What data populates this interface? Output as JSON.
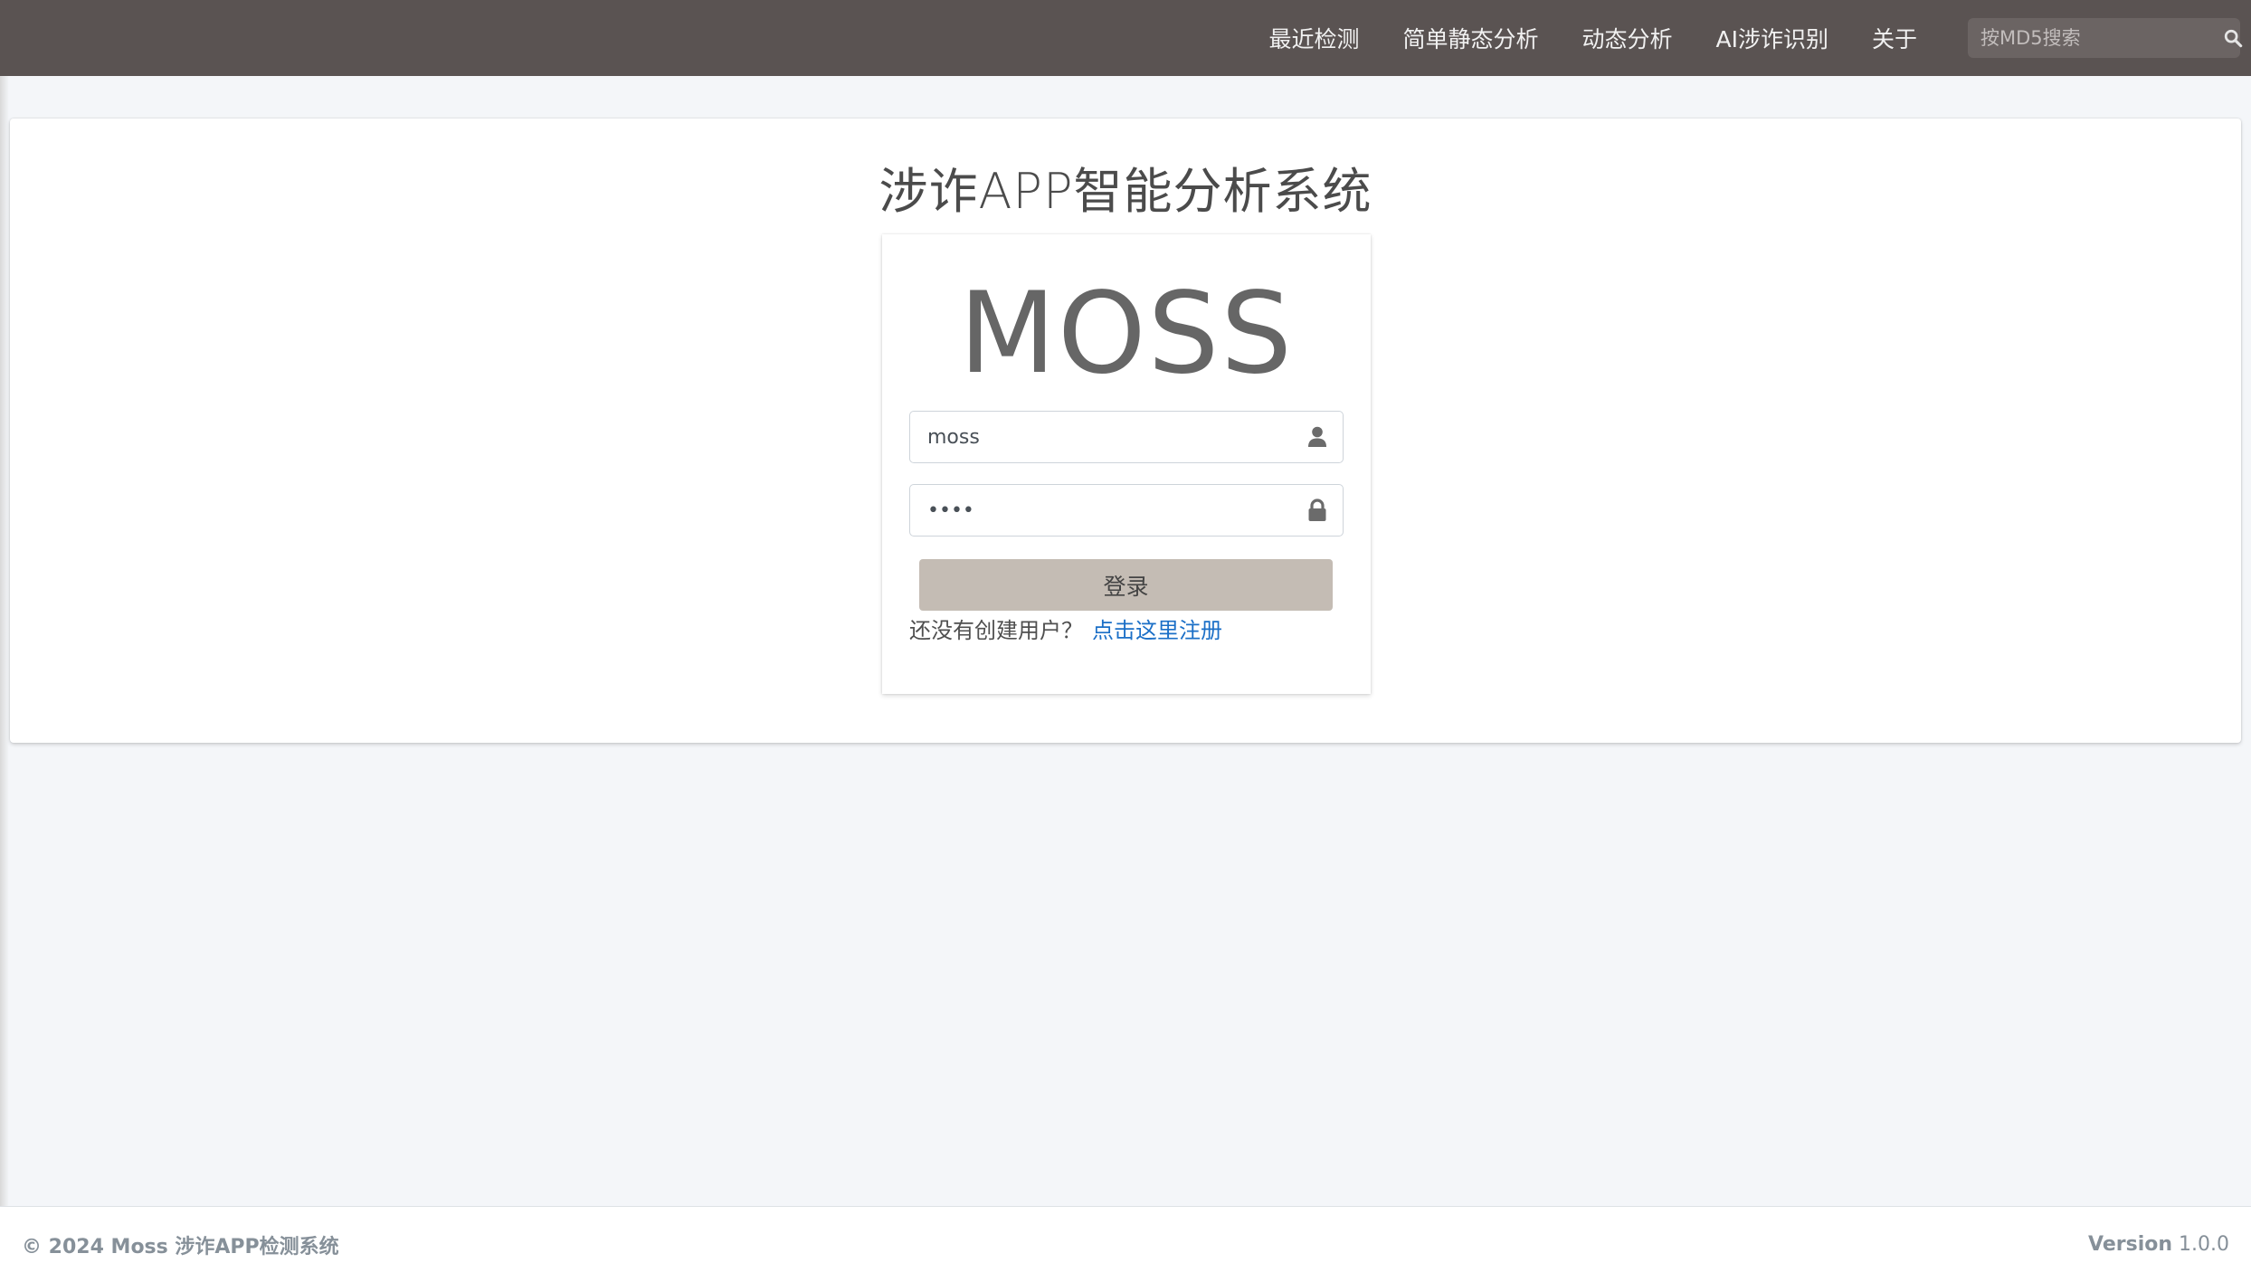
{
  "navbar": {
    "links": [
      "最近检测",
      "简单静态分析",
      "动态分析",
      "AI涉诈识别",
      "关于"
    ],
    "search_placeholder": "按MD5搜索",
    "search_icon": "search-icon"
  },
  "main": {
    "title": "涉诈APP智能分析系统"
  },
  "login": {
    "logo": "MOSS",
    "username_value": "moss",
    "password_value": "moss",
    "user_icon": "user-icon",
    "lock_icon": "lock-icon",
    "submit_label": "登录",
    "register_prompt": "还没有创建用户？",
    "register_link": "点击这里注册"
  },
  "footer": {
    "copyright": "© 2024 Moss 涉诈APP检测系统",
    "version_label": "Version",
    "version_number": "1.0.0"
  },
  "colors": {
    "navbar_bg": "#5a5352",
    "login_button": "#c4bcb4",
    "link": "#1b6fc7"
  }
}
